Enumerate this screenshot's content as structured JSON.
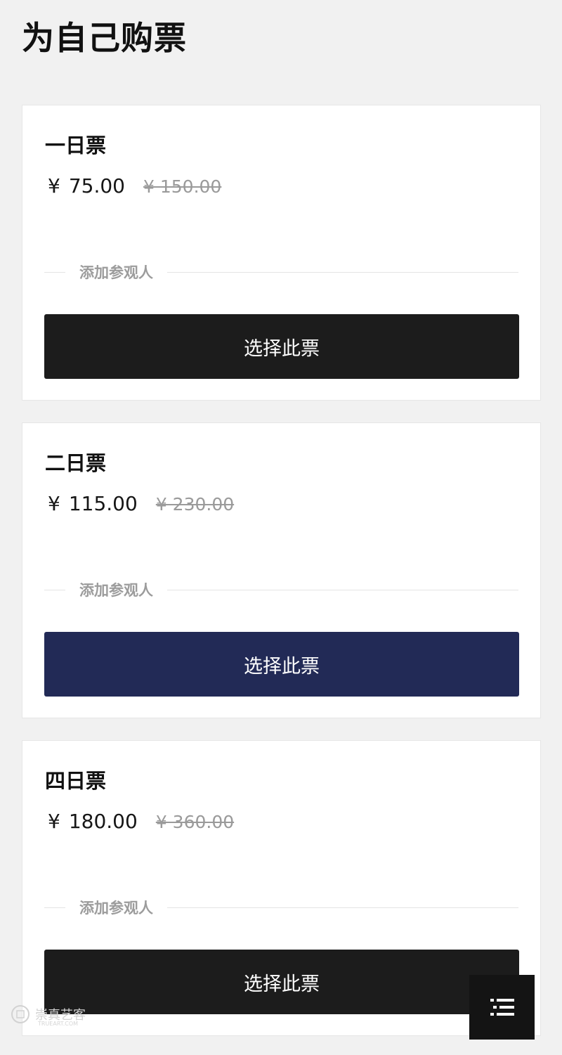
{
  "page": {
    "title": "为自己购票"
  },
  "tickets": [
    {
      "name": "一日票",
      "currency": "¥",
      "price": "75.00",
      "original_price": "¥ 150.00",
      "add_visitor_label": "添加参观人",
      "button_label": "选择此票",
      "button_color": "#1c1c1c"
    },
    {
      "name": "二日票",
      "currency": "¥",
      "price": "115.00",
      "original_price": "¥ 230.00",
      "add_visitor_label": "添加参观人",
      "button_label": "选择此票",
      "button_color": "#222a56"
    },
    {
      "name": "四日票",
      "currency": "¥",
      "price": "180.00",
      "original_price": "¥ 360.00",
      "add_visitor_label": "添加参观人",
      "button_label": "选择此票",
      "button_color": "#1c1c1c"
    }
  ],
  "menu_fab": {
    "icon": "list-menu-icon"
  },
  "watermark": {
    "text": "崇真艺客",
    "sub": "TRUEART.COM"
  }
}
